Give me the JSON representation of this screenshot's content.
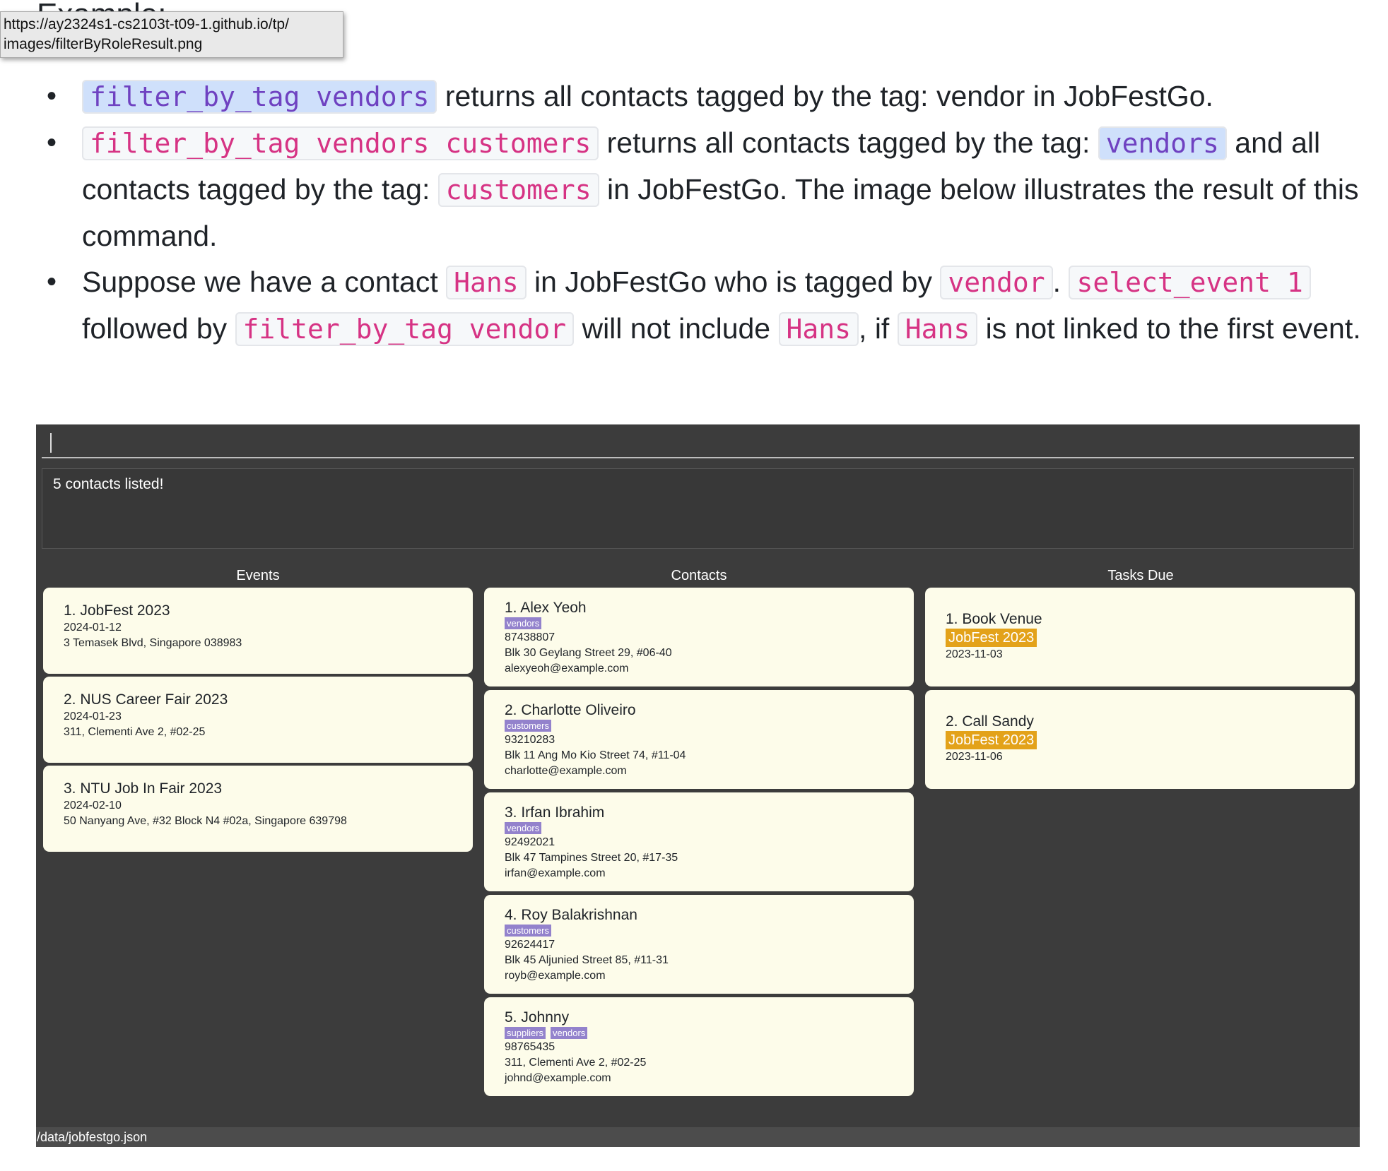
{
  "page": {
    "partial_heading": "Example:"
  },
  "tooltip": {
    "text": "https://ay2324s1-cs2103t-t09-1.github.io/tp/ images/filterByRoleResult.png"
  },
  "doc": {
    "b1": {
      "code": "filter_by_tag vendors",
      "t1": " returns all contacts tagged by the tag: vendor in JobFestGo."
    },
    "b2": {
      "code1": "filter_by_tag vendors customers",
      "t1": " returns all contacts tagged by the tag: ",
      "code2": "vendors",
      "t2": " and all contacts tagged by the tag: ",
      "code3": "customers",
      "t3": " in JobFestGo. The image below illustrates the result of this command."
    },
    "b3": {
      "t1": "Suppose we have a contact ",
      "code1": "Hans",
      "t2": " in JobFestGo who is tagged by ",
      "code2": "vendor",
      "t3": ". ",
      "code3": "select_event 1",
      "t4": " followed by ",
      "code4": "filter_by_tag vendor",
      "t5": " will not include ",
      "code5": "Hans",
      "t6": ", if ",
      "code6": "Hans",
      "t7": " is not linked to the first event."
    }
  },
  "app": {
    "result_text": "5 contacts listed!",
    "events_title": "Events",
    "contacts_title": "Contacts",
    "tasks_title": "Tasks Due",
    "status_bar": "/data/jobfestgo.json",
    "events": [
      {
        "name": "1.  JobFest 2023",
        "date": "2024-01-12",
        "address": "3 Temasek Blvd, Singapore 038983"
      },
      {
        "name": "2.  NUS Career Fair 2023",
        "date": "2024-01-23",
        "address": "311, Clementi Ave 2, #02-25"
      },
      {
        "name": "3.  NTU Job In Fair 2023",
        "date": "2024-02-10",
        "address": "50 Nanyang Ave, #32 Block N4 #02a, Singapore 639798"
      }
    ],
    "contacts": [
      {
        "name": "1.  Alex Yeoh",
        "tags": [
          "vendors"
        ],
        "phone": "87438807",
        "address": "Blk 30 Geylang Street 29, #06-40",
        "email": "alexyeoh@example.com"
      },
      {
        "name": "2.  Charlotte Oliveiro",
        "tags": [
          "customers"
        ],
        "phone": "93210283",
        "address": "Blk 11 Ang Mo Kio Street 74, #11-04",
        "email": "charlotte@example.com"
      },
      {
        "name": "3.  Irfan Ibrahim",
        "tags": [
          "vendors"
        ],
        "phone": "92492021",
        "address": "Blk 47 Tampines Street 20, #17-35",
        "email": "irfan@example.com"
      },
      {
        "name": "4.  Roy Balakrishnan",
        "tags": [
          "customers"
        ],
        "phone": "92624417",
        "address": "Blk 45 Aljunied Street 85, #11-31",
        "email": "royb@example.com"
      },
      {
        "name": "5.  Johnny",
        "tags": [
          "suppliers",
          "vendors"
        ],
        "phone": "98765435",
        "address": "311, Clementi Ave 2, #02-25",
        "email": "johnd@example.com"
      }
    ],
    "tasks": [
      {
        "name": "1.  Book Venue",
        "event": "JobFest 2023",
        "date": "2023-11-03"
      },
      {
        "name": "2.  Call Sandy",
        "event": "JobFest 2023",
        "date": "2023-11-06"
      }
    ]
  }
}
